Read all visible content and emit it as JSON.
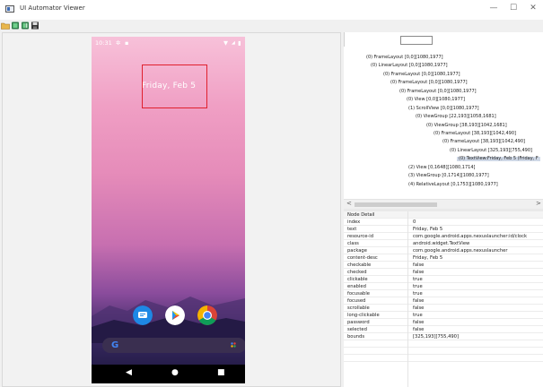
{
  "window": {
    "title": "UI Automator Viewer",
    "controls": [
      "—",
      "☐",
      "✕"
    ]
  },
  "toolbar": {
    "tools": [
      "open-folder-icon",
      "device-screenshot-icon",
      "device-screenshot-compressed-icon",
      "save-icon"
    ]
  },
  "device": {
    "status_time": "10:31",
    "date_text": "Friday, Feb 5",
    "search_logo": "G",
    "nav": [
      "◀",
      "●",
      "■"
    ]
  },
  "tree": {
    "nodes": [
      "(0) FrameLayout [0,0][1080,1977]",
      "(0) LinearLayout [0,0][1080,1977]",
      "(0) FrameLayout [0,0][1080,1977]",
      "(0) FrameLayout [0,0][1080,1977]",
      "(0) FrameLayout [0,0][1080,1977]",
      "(0) View [0,0][1080,1977]",
      "(1) ScrollView [0,0][1080,1977]",
      "(0) ViewGroup [22,193][1058,1681]",
      "(0) ViewGroup [38,193][1042,1681]",
      "(0) FrameLayout [38,193][1042,490]",
      "(0) FrameLayout [38,193][1042,490]",
      "(0) LinearLayout [325,193][755,490]",
      "(0) TextView:Friday, Feb 5 (Friday, F",
      "(2) View [0,1648][1080,1714]",
      "(3) ViewGroup [0,1714][1080,1977]",
      "(4) RelativeLayout [0,1753][1080,1977]"
    ]
  },
  "scroll": {
    "left": "<",
    "right": ">"
  },
  "detail": {
    "header": "Node Detail",
    "rows": [
      [
        "index",
        "0"
      ],
      [
        "text",
        "Friday, Feb 5"
      ],
      [
        "resource-id",
        "com.google.android.apps.nexuslauncher:id/clock"
      ],
      [
        "class",
        "android.widget.TextView"
      ],
      [
        "package",
        "com.google.android.apps.nexuslauncher"
      ],
      [
        "content-desc",
        "Friday, Feb 5"
      ],
      [
        "checkable",
        "false"
      ],
      [
        "checked",
        "false"
      ],
      [
        "clickable",
        "true"
      ],
      [
        "enabled",
        "true"
      ],
      [
        "focusable",
        "true"
      ],
      [
        "focused",
        "false"
      ],
      [
        "scrollable",
        "false"
      ],
      [
        "long-clickable",
        "true"
      ],
      [
        "password",
        "false"
      ],
      [
        "selected",
        "false"
      ],
      [
        "bounds",
        "[325,193][755,490]"
      ]
    ]
  }
}
